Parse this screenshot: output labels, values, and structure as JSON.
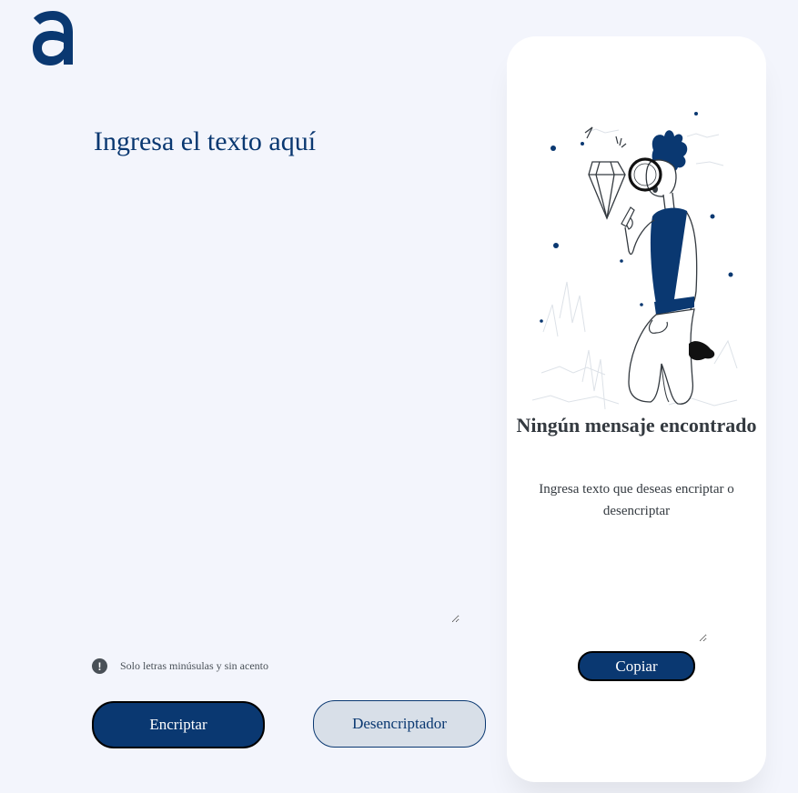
{
  "brand": {
    "logo_icon": "alura-a-logo-icon",
    "color": "#0a3871"
  },
  "input": {
    "placeholder": "Ingresa el texto aquí",
    "value": ""
  },
  "hint": {
    "icon": "exclamation-circle-icon",
    "text": "Solo letras minúsulas y sin acento"
  },
  "buttons": {
    "encrypt_label": "Encriptar",
    "decrypt_label": "Desencriptador"
  },
  "result_panel": {
    "illustration": "person-with-magnifier-and-diamond-illustration",
    "title": "Ningún mensaje encontrado",
    "description": "Ingresa texto que deseas encriptar o desencriptar",
    "output_value": "",
    "copy_label": "Copiar"
  },
  "colors": {
    "background": "#f3f5fc",
    "primary": "#0a3871",
    "secondary_button": "#d8dfe8",
    "text_dark": "#343a40"
  }
}
